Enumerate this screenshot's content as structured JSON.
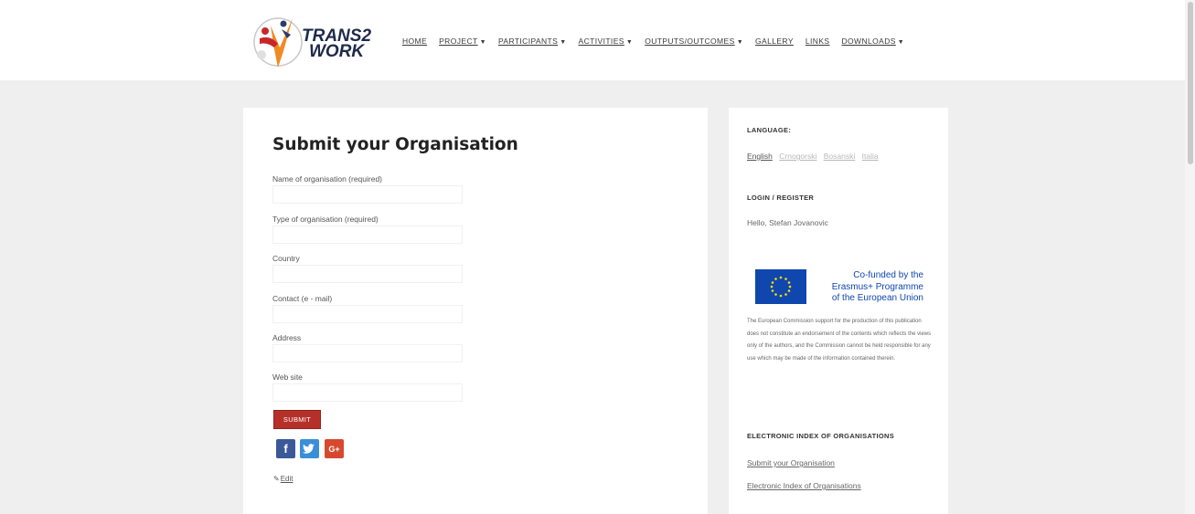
{
  "header": {
    "logo": {
      "line1": "TRANS2",
      "line2": "WORK"
    },
    "nav": [
      {
        "label": "HOME",
        "dropdown": false
      },
      {
        "label": "PROJECT",
        "dropdown": true
      },
      {
        "label": "PARTICIPANTS",
        "dropdown": true
      },
      {
        "label": "ACTIVITIES",
        "dropdown": true
      },
      {
        "label": "OUTPUTS/OUTCOMES",
        "dropdown": true
      },
      {
        "label": "GALLERY",
        "dropdown": false
      },
      {
        "label": "LINKS",
        "dropdown": false
      },
      {
        "label": "DOWNLOADS",
        "dropdown": true
      }
    ]
  },
  "form": {
    "title": "Submit your Organisation",
    "fields": [
      {
        "label": "Name of organisation (required)",
        "value": ""
      },
      {
        "label": "Type of organisation (required)",
        "value": ""
      },
      {
        "label": "Country",
        "value": ""
      },
      {
        "label": "Contact (e - mail)",
        "value": ""
      },
      {
        "label": "Address",
        "value": ""
      },
      {
        "label": "Web site",
        "value": ""
      }
    ],
    "submit_label": "SUBMIT",
    "edit_label": "Edit"
  },
  "sidebar": {
    "language_heading": "LANGUAGE:",
    "languages": [
      {
        "label": "English",
        "active": true
      },
      {
        "label": "Crnogorski",
        "active": false
      },
      {
        "label": "Bosanski",
        "active": false
      },
      {
        "label": "Italia",
        "active": false
      }
    ],
    "login_heading": "LOGIN / REGISTER",
    "hello_text": "Hello, Stefan Jovanovic",
    "eu": {
      "line1": "Co-funded by the",
      "line2": "Erasmus+ Programme",
      "line3": "of the European Union"
    },
    "disclaimer": "The European Commission support for the production of this publication does not constitute an endorsement of the contents which reflects the views only of the authors, and the Commission cannot be held responsible for any use which may be made of the information contained therein.",
    "index_heading": "ELECTRONIC INDEX OF ORGANISATIONS",
    "links": [
      "Submit your Organisation",
      "Electronic Index of Organisations"
    ]
  },
  "colors": {
    "accent_red": "#b6302a",
    "eu_blue": "#0f47af",
    "facebook": "#3b5998",
    "twitter": "#3a8fd8",
    "google_plus": "#d6492f"
  },
  "icons": {
    "facebook": "facebook-icon",
    "twitter": "twitter-icon",
    "google_plus": "google-plus-icon",
    "edit": "pencil-icon"
  }
}
